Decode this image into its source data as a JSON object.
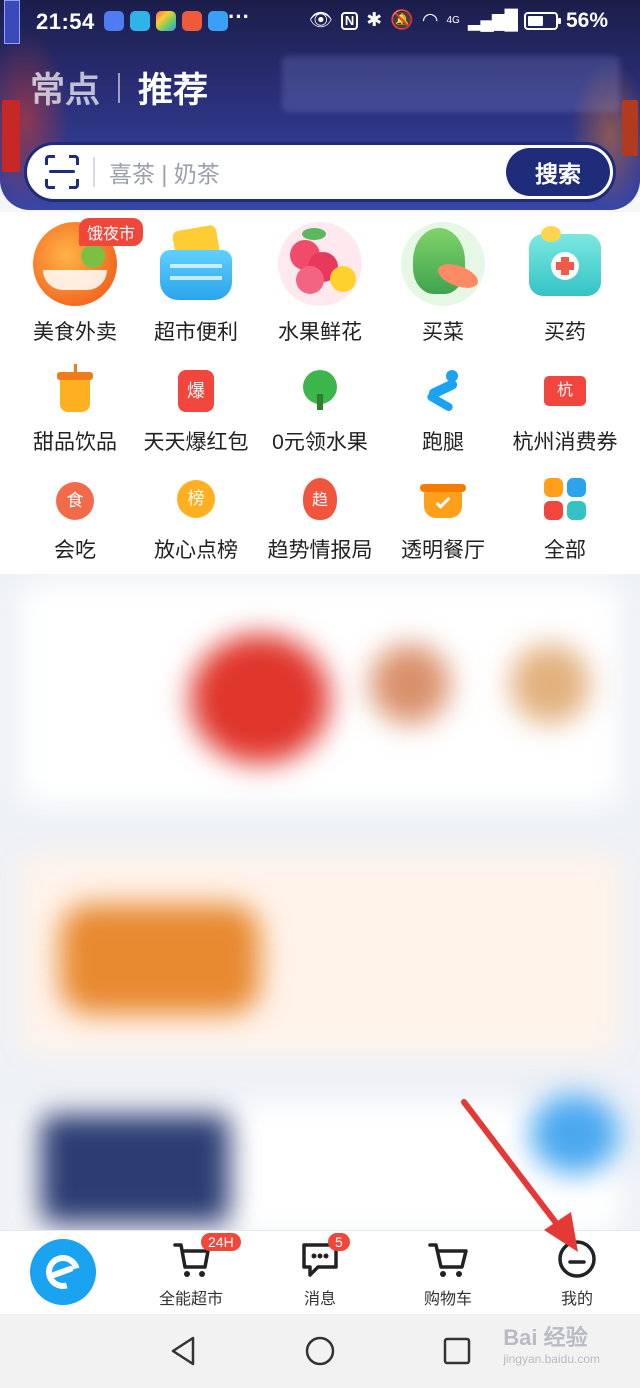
{
  "status_bar": {
    "time": "21:54",
    "more": "···",
    "network": "4G",
    "battery_percent": "56%",
    "battery_level": 0.56
  },
  "header": {
    "tabs": [
      "常点",
      "推荐"
    ]
  },
  "search": {
    "placeholder": "喜茶 | 奶茶",
    "button": "搜索"
  },
  "categories_main": [
    {
      "label": "美食外卖",
      "icon": "food-delivery-icon",
      "badge": "饿夜市"
    },
    {
      "label": "超市便利",
      "icon": "supermarket-basket-icon"
    },
    {
      "label": "水果鲜花",
      "icon": "fruit-flower-icon"
    },
    {
      "label": "买菜",
      "icon": "vegetables-icon"
    },
    {
      "label": "买药",
      "icon": "medicine-box-icon"
    }
  ],
  "categories_row2": [
    {
      "label": "甜品饮品",
      "icon": "drink-cup-icon",
      "glyph": ""
    },
    {
      "label": "天天爆红包",
      "icon": "red-packet-icon",
      "glyph": "爆"
    },
    {
      "label": "0元领水果",
      "icon": "tree-icon",
      "glyph": ""
    },
    {
      "label": "跑腿",
      "icon": "runner-icon",
      "glyph": ""
    },
    {
      "label": "杭州消费券",
      "icon": "coupon-icon",
      "glyph": "杭"
    }
  ],
  "categories_row3": [
    {
      "label": "会吃",
      "icon": "eat-bowl-icon",
      "glyph": "食"
    },
    {
      "label": "放心点榜",
      "icon": "ranking-badge-icon",
      "glyph": "榜"
    },
    {
      "label": "趋势情报局",
      "icon": "trend-flame-icon",
      "glyph": "趋"
    },
    {
      "label": "透明餐厅",
      "icon": "transparent-kitchen-icon",
      "glyph": ""
    },
    {
      "label": "全部",
      "icon": "all-grid-icon",
      "glyph": ""
    }
  ],
  "bottom_nav": [
    {
      "label": "",
      "icon": "eleme-home-icon"
    },
    {
      "label": "全能超市",
      "icon": "supermarket-cart-icon",
      "badge": "24H"
    },
    {
      "label": "消息",
      "icon": "message-icon",
      "badge": "5"
    },
    {
      "label": "购物车",
      "icon": "shopping-cart-icon"
    },
    {
      "label": "我的",
      "icon": "profile-face-icon"
    }
  ],
  "colors": {
    "brand_blue": "#1f2c7a",
    "eleme_blue": "#1aa3f0",
    "badge_red": "#f1473a",
    "annotation_arrow": "#e53935"
  },
  "watermark": {
    "brand": "Bai 经验",
    "url": "jingyan.baidu.com"
  }
}
